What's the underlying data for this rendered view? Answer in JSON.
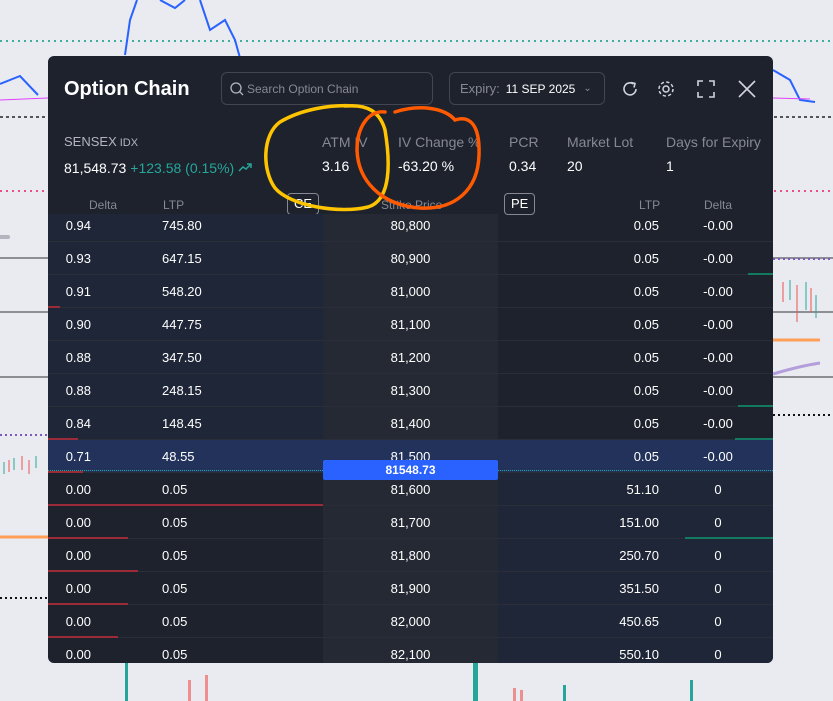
{
  "colors": {
    "up": "#26a69a",
    "down": "#ef5350",
    "accent": "#2962ff",
    "annotation_yellow": "#ffc400",
    "annotation_orange": "#ff5a00"
  },
  "header": {
    "title": "Option Chain",
    "search_placeholder": "Search Option Chain",
    "expiry_label": "Expiry:",
    "expiry_value": "11 SEP 2025",
    "icons": [
      "refresh-icon",
      "gear-icon",
      "fullscreen-icon",
      "close-icon"
    ]
  },
  "summary": {
    "symbol": "SENSEX",
    "symbol_type": "IDX",
    "ltp": "81,548.73",
    "change": "+123.58 (0.15%)",
    "atm_iv_label": "ATM IV",
    "atm_iv_value": "3.16",
    "iv_change_label": "IV Change %",
    "iv_change_value": "-63.20 %",
    "pcr_label": "PCR",
    "pcr_value": "0.34",
    "lot_label": "Market Lot",
    "lot_value": "20",
    "days_label": "Days for Expiry",
    "days_value": "1"
  },
  "columns": {
    "ce_delta": "Delta",
    "ce_ltp": "LTP",
    "ce_badge": "CE",
    "strike": "Strike Price",
    "pe_badge": "PE",
    "pe_ltp": "LTP",
    "pe_delta": "Delta"
  },
  "spot_label": "81548.73",
  "rows": [
    {
      "ce_delta": "0.94",
      "ce_ltp": "745.80",
      "strike": "80,800",
      "pe_ltp": "0.05",
      "pe_delta": "-0.00"
    },
    {
      "ce_delta": "0.93",
      "ce_ltp": "647.15",
      "strike": "80,900",
      "pe_ltp": "0.05",
      "pe_delta": "-0.00"
    },
    {
      "ce_delta": "0.91",
      "ce_ltp": "548.20",
      "strike": "81,000",
      "pe_ltp": "0.05",
      "pe_delta": "-0.00"
    },
    {
      "ce_delta": "0.90",
      "ce_ltp": "447.75",
      "strike": "81,100",
      "pe_ltp": "0.05",
      "pe_delta": "-0.00"
    },
    {
      "ce_delta": "0.88",
      "ce_ltp": "347.50",
      "strike": "81,200",
      "pe_ltp": "0.05",
      "pe_delta": "-0.00"
    },
    {
      "ce_delta": "0.88",
      "ce_ltp": "248.15",
      "strike": "81,300",
      "pe_ltp": "0.05",
      "pe_delta": "-0.00"
    },
    {
      "ce_delta": "0.84",
      "ce_ltp": "148.45",
      "strike": "81,400",
      "pe_ltp": "0.05",
      "pe_delta": "-0.00"
    },
    {
      "ce_delta": "0.71",
      "ce_ltp": "48.55",
      "strike": "81,500",
      "pe_ltp": "0.05",
      "pe_delta": "-0.00"
    },
    {
      "ce_delta": "0.00",
      "ce_ltp": "0.05",
      "strike": "81,600",
      "pe_ltp": "51.10",
      "pe_delta": "0"
    },
    {
      "ce_delta": "0.00",
      "ce_ltp": "0.05",
      "strike": "81,700",
      "pe_ltp": "151.00",
      "pe_delta": "0"
    },
    {
      "ce_delta": "0.00",
      "ce_ltp": "0.05",
      "strike": "81,800",
      "pe_ltp": "250.70",
      "pe_delta": "0"
    },
    {
      "ce_delta": "0.00",
      "ce_ltp": "0.05",
      "strike": "81,900",
      "pe_ltp": "351.50",
      "pe_delta": "0"
    },
    {
      "ce_delta": "0.00",
      "ce_ltp": "0.05",
      "strike": "82,000",
      "pe_ltp": "450.65",
      "pe_delta": "0"
    },
    {
      "ce_delta": "0.00",
      "ce_ltp": "0.05",
      "strike": "82,100",
      "pe_ltp": "550.10",
      "pe_delta": "0"
    }
  ]
}
